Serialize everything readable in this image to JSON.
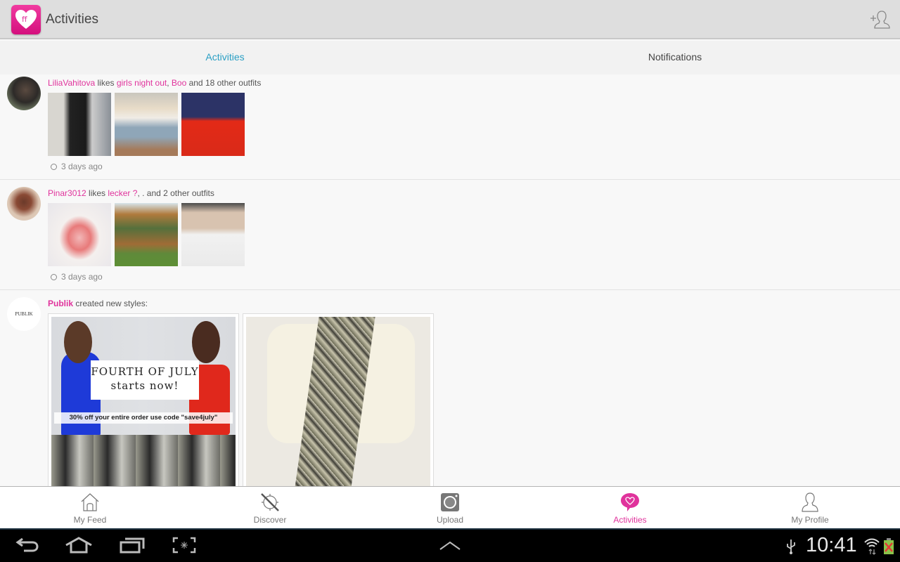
{
  "app": {
    "title": "Activities",
    "logo_icon": "heart-ff-logo",
    "add_user_icon": "add-user-icon"
  },
  "tabs": [
    {
      "label": "Activities",
      "active": true
    },
    {
      "label": "Notifications",
      "active": false
    }
  ],
  "feed": [
    {
      "user": "LiliaVahitova",
      "verb": " likes ",
      "links": [
        "girls night out",
        "Boo"
      ],
      "separator": ", ",
      "suffix": " and 18 other outfits",
      "thumbnails": [
        "outfit-black-jacket-leather-pants",
        "outfit-denim-shorts-white-top",
        "outfit-navy-blouse-red-pants"
      ],
      "time": "3 days ago"
    },
    {
      "user": "Pinar3012",
      "verb": " likes ",
      "links": [
        "lecker ?"
      ],
      "separator": "",
      "suffix": ", . and 2 other outfits",
      "thumbnails": [
        "strawberry-heart-cake",
        "wooden-pergola-swing",
        "white-jeans-beige-top"
      ],
      "time": "3 days ago"
    },
    {
      "user": "Publik",
      "verb": " created new styles:",
      "avatar_text": "PUBLIK",
      "styles": [
        {
          "name": "fourth-of-july-promo",
          "headline": "FOURTH OF JULY starts now!",
          "caption": "30% off your entire order use code \"save4july\""
        },
        {
          "name": "snakeskin-dress-white-blazer"
        }
      ]
    }
  ],
  "bottom_nav": [
    {
      "label": "My Feed",
      "icon": "home-icon",
      "active": false
    },
    {
      "label": "Discover",
      "icon": "compass-icon",
      "active": false
    },
    {
      "label": "Upload",
      "icon": "camera-icon",
      "active": false
    },
    {
      "label": "Activities",
      "icon": "heart-bubble-icon",
      "active": true
    },
    {
      "label": "My Profile",
      "icon": "profile-icon",
      "active": false
    }
  ],
  "system_bar": {
    "time": "10:41"
  },
  "colors": {
    "accent_pink": "#e0339c",
    "active_tab_blue": "#2a9fc4"
  }
}
